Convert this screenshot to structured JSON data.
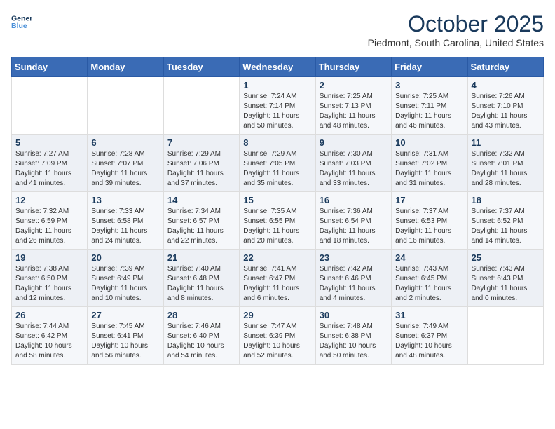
{
  "header": {
    "logo_line1": "General",
    "logo_line2": "Blue",
    "month": "October 2025",
    "location": "Piedmont, South Carolina, United States"
  },
  "days_of_week": [
    "Sunday",
    "Monday",
    "Tuesday",
    "Wednesday",
    "Thursday",
    "Friday",
    "Saturday"
  ],
  "weeks": [
    [
      {
        "day": "",
        "info": ""
      },
      {
        "day": "",
        "info": ""
      },
      {
        "day": "",
        "info": ""
      },
      {
        "day": "1",
        "info": "Sunrise: 7:24 AM\nSunset: 7:14 PM\nDaylight: 11 hours\nand 50 minutes."
      },
      {
        "day": "2",
        "info": "Sunrise: 7:25 AM\nSunset: 7:13 PM\nDaylight: 11 hours\nand 48 minutes."
      },
      {
        "day": "3",
        "info": "Sunrise: 7:25 AM\nSunset: 7:11 PM\nDaylight: 11 hours\nand 46 minutes."
      },
      {
        "day": "4",
        "info": "Sunrise: 7:26 AM\nSunset: 7:10 PM\nDaylight: 11 hours\nand 43 minutes."
      }
    ],
    [
      {
        "day": "5",
        "info": "Sunrise: 7:27 AM\nSunset: 7:09 PM\nDaylight: 11 hours\nand 41 minutes."
      },
      {
        "day": "6",
        "info": "Sunrise: 7:28 AM\nSunset: 7:07 PM\nDaylight: 11 hours\nand 39 minutes."
      },
      {
        "day": "7",
        "info": "Sunrise: 7:29 AM\nSunset: 7:06 PM\nDaylight: 11 hours\nand 37 minutes."
      },
      {
        "day": "8",
        "info": "Sunrise: 7:29 AM\nSunset: 7:05 PM\nDaylight: 11 hours\nand 35 minutes."
      },
      {
        "day": "9",
        "info": "Sunrise: 7:30 AM\nSunset: 7:03 PM\nDaylight: 11 hours\nand 33 minutes."
      },
      {
        "day": "10",
        "info": "Sunrise: 7:31 AM\nSunset: 7:02 PM\nDaylight: 11 hours\nand 31 minutes."
      },
      {
        "day": "11",
        "info": "Sunrise: 7:32 AM\nSunset: 7:01 PM\nDaylight: 11 hours\nand 28 minutes."
      }
    ],
    [
      {
        "day": "12",
        "info": "Sunrise: 7:32 AM\nSunset: 6:59 PM\nDaylight: 11 hours\nand 26 minutes."
      },
      {
        "day": "13",
        "info": "Sunrise: 7:33 AM\nSunset: 6:58 PM\nDaylight: 11 hours\nand 24 minutes."
      },
      {
        "day": "14",
        "info": "Sunrise: 7:34 AM\nSunset: 6:57 PM\nDaylight: 11 hours\nand 22 minutes."
      },
      {
        "day": "15",
        "info": "Sunrise: 7:35 AM\nSunset: 6:55 PM\nDaylight: 11 hours\nand 20 minutes."
      },
      {
        "day": "16",
        "info": "Sunrise: 7:36 AM\nSunset: 6:54 PM\nDaylight: 11 hours\nand 18 minutes."
      },
      {
        "day": "17",
        "info": "Sunrise: 7:37 AM\nSunset: 6:53 PM\nDaylight: 11 hours\nand 16 minutes."
      },
      {
        "day": "18",
        "info": "Sunrise: 7:37 AM\nSunset: 6:52 PM\nDaylight: 11 hours\nand 14 minutes."
      }
    ],
    [
      {
        "day": "19",
        "info": "Sunrise: 7:38 AM\nSunset: 6:50 PM\nDaylight: 11 hours\nand 12 minutes."
      },
      {
        "day": "20",
        "info": "Sunrise: 7:39 AM\nSunset: 6:49 PM\nDaylight: 11 hours\nand 10 minutes."
      },
      {
        "day": "21",
        "info": "Sunrise: 7:40 AM\nSunset: 6:48 PM\nDaylight: 11 hours\nand 8 minutes."
      },
      {
        "day": "22",
        "info": "Sunrise: 7:41 AM\nSunset: 6:47 PM\nDaylight: 11 hours\nand 6 minutes."
      },
      {
        "day": "23",
        "info": "Sunrise: 7:42 AM\nSunset: 6:46 PM\nDaylight: 11 hours\nand 4 minutes."
      },
      {
        "day": "24",
        "info": "Sunrise: 7:43 AM\nSunset: 6:45 PM\nDaylight: 11 hours\nand 2 minutes."
      },
      {
        "day": "25",
        "info": "Sunrise: 7:43 AM\nSunset: 6:43 PM\nDaylight: 11 hours\nand 0 minutes."
      }
    ],
    [
      {
        "day": "26",
        "info": "Sunrise: 7:44 AM\nSunset: 6:42 PM\nDaylight: 10 hours\nand 58 minutes."
      },
      {
        "day": "27",
        "info": "Sunrise: 7:45 AM\nSunset: 6:41 PM\nDaylight: 10 hours\nand 56 minutes."
      },
      {
        "day": "28",
        "info": "Sunrise: 7:46 AM\nSunset: 6:40 PM\nDaylight: 10 hours\nand 54 minutes."
      },
      {
        "day": "29",
        "info": "Sunrise: 7:47 AM\nSunset: 6:39 PM\nDaylight: 10 hours\nand 52 minutes."
      },
      {
        "day": "30",
        "info": "Sunrise: 7:48 AM\nSunset: 6:38 PM\nDaylight: 10 hours\nand 50 minutes."
      },
      {
        "day": "31",
        "info": "Sunrise: 7:49 AM\nSunset: 6:37 PM\nDaylight: 10 hours\nand 48 minutes."
      },
      {
        "day": "",
        "info": ""
      }
    ]
  ]
}
